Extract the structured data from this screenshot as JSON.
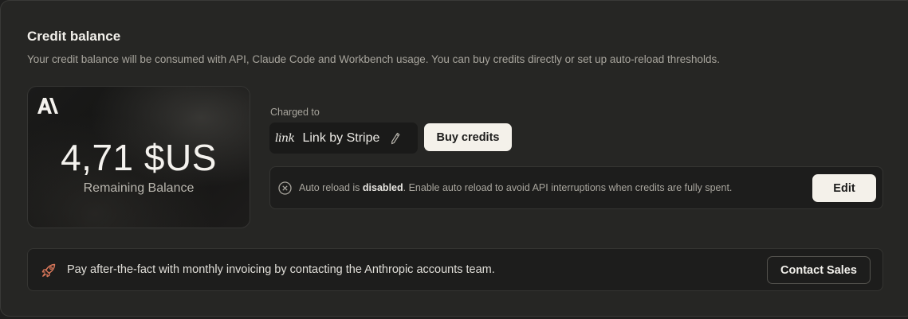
{
  "section": {
    "title": "Credit balance",
    "description": "Your credit balance will be consumed with API, Claude Code and Workbench usage. You can buy credits directly or set up auto-reload thresholds."
  },
  "balance": {
    "amount": "4,71 $US",
    "label": "Remaining Balance",
    "logo_icon": "anthropic-logo-icon"
  },
  "payment": {
    "charged_to_label": "Charged to",
    "method_logo": "link",
    "method_name": "Link by Stripe",
    "edit_icon": "pencil-icon"
  },
  "actions": {
    "buy_label": "Buy credits",
    "edit_label": "Edit",
    "contact_label": "Contact Sales"
  },
  "auto_reload": {
    "icon": "circle-x-icon",
    "prefix": "Auto reload is ",
    "status": "disabled",
    "suffix": ". Enable auto reload to avoid API interruptions when credits are fully spent."
  },
  "invoicing": {
    "icon": "rocket-icon",
    "text": "Pay after-the-fact with monthly invoicing by contacting the Anthropic accounts team."
  },
  "colors": {
    "accent_icon": "#d9775a",
    "button_light": "#f4f1ea",
    "panel_bg": "#262624"
  }
}
